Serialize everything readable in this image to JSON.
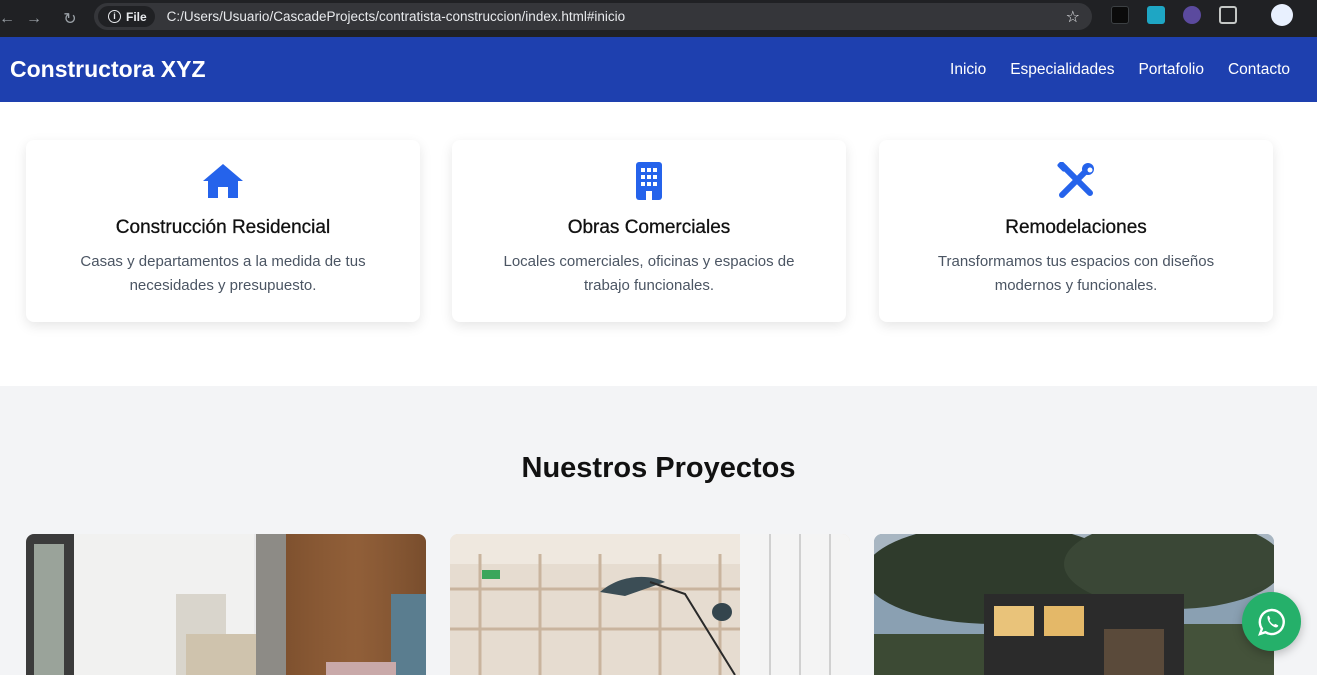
{
  "browser": {
    "scheme_chip": "File",
    "url": "C:/Users/Usuario/CascadeProjects/contratista-construccion/index.html#inicio"
  },
  "header": {
    "brand": "Constructora XYZ",
    "nav": [
      {
        "label": "Inicio"
      },
      {
        "label": "Especialidades"
      },
      {
        "label": "Portafolio"
      },
      {
        "label": "Contacto"
      }
    ]
  },
  "services": [
    {
      "icon": "house-icon",
      "title": "Construcción Residencial",
      "description": "Casas y departamentos a la medida de tus necesidades y presupuesto."
    },
    {
      "icon": "building-icon",
      "title": "Obras Comerciales",
      "description": "Locales comerciales, oficinas y espacios de trabajo funcionales."
    },
    {
      "icon": "tools-icon",
      "title": "Remodelaciones",
      "description": "Transformamos tus espacios con diseños modernos y funcionales."
    }
  ],
  "projects": {
    "heading": "Nuestros Proyectos",
    "items": [
      {
        "image": "living-room-photo"
      },
      {
        "image": "office-interior-photo"
      },
      {
        "image": "modern-house-exterior-photo"
      }
    ]
  },
  "colors": {
    "header_bg": "#1e40af",
    "icon_blue": "#2563eb",
    "whatsapp_green": "#25b06a",
    "section_gray": "#f3f4f6"
  }
}
